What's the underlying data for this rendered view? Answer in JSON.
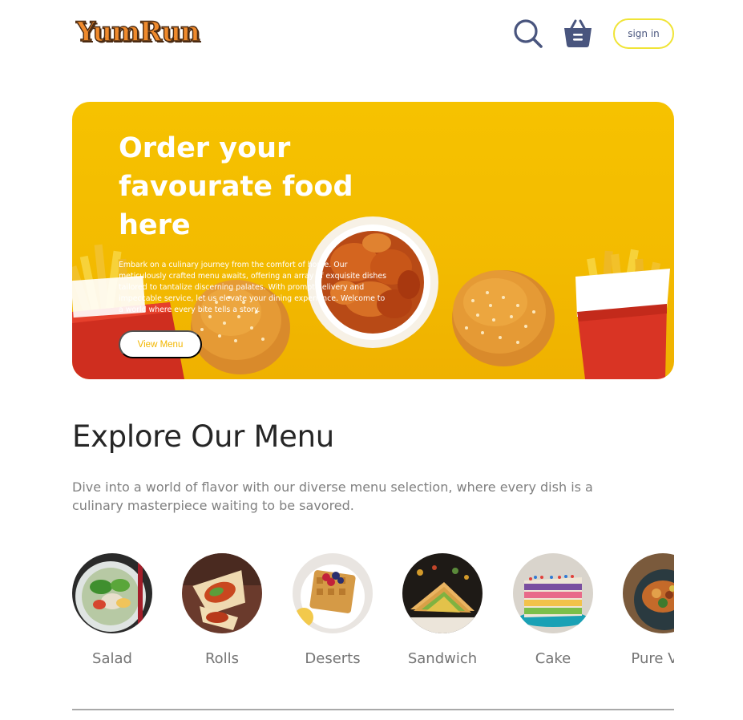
{
  "navbar": {
    "logo": "YumRun",
    "search_icon": "search-icon",
    "basket_icon": "basket-icon",
    "sign_in": "sign in"
  },
  "hero": {
    "title": "Order your favourate food here",
    "description": "Embark on a culinary journey from the comfort of home. Our meticulously crafted menu awaits, offering an array of exquisite dishes tailored to tantalize discerning palates. With prompt delivery and impeccable service, let us elevate your dining experience. Welcome to a world where every bite tells a story.",
    "button": "View Menu"
  },
  "menu": {
    "title": "Explore Our Menu",
    "description": "Dive into a world of flavor with our diverse menu selection, where every dish is a culinary masterpiece waiting to be savored.",
    "items": [
      {
        "label": "Salad"
      },
      {
        "label": "Rolls"
      },
      {
        "label": "Deserts"
      },
      {
        "label": "Sandwich"
      },
      {
        "label": "Cake"
      },
      {
        "label": "Pure Veg"
      }
    ]
  },
  "colors": {
    "brand": "#f2b600",
    "accent_border": "#f0e436",
    "nav_icon": "#49557e"
  }
}
